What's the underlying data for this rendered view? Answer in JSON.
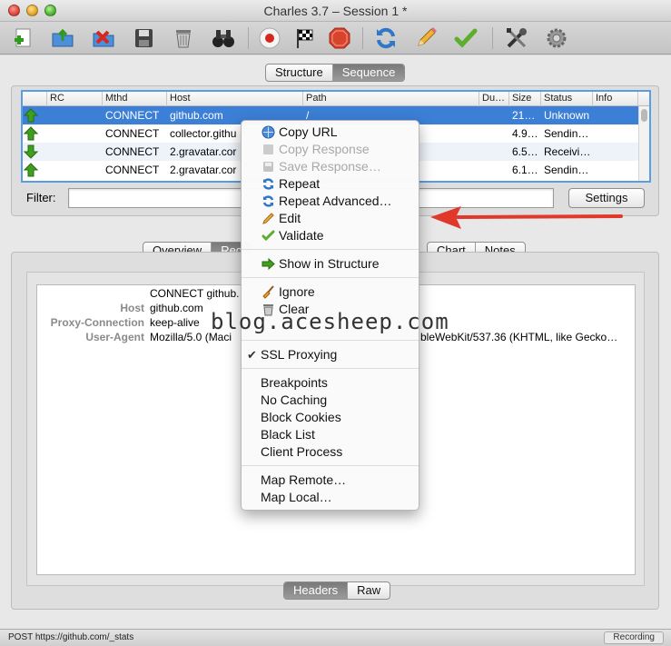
{
  "window": {
    "title": "Charles 3.7 – Session 1 *"
  },
  "toolbar": {
    "buttons": [
      "new-session-icon",
      "open-session-icon",
      "close-session-icon",
      "save-icon",
      "trash-icon",
      "binoculars-icon",
      "record-icon",
      "throttle-flag-icon",
      "breakpoints-stop-icon",
      "repeat-icon",
      "edit-pencil-icon",
      "validate-check-icon",
      "tools-icon",
      "settings-gear-icon"
    ]
  },
  "view_tabs": {
    "structure": "Structure",
    "sequence": "Sequence",
    "active": "Sequence"
  },
  "table": {
    "columns": [
      "RC",
      "Mthd",
      "Host",
      "Path",
      "Du…",
      "Size",
      "Status",
      "Info"
    ],
    "rows": [
      {
        "direction": "up",
        "rc": "",
        "method": "CONNECT",
        "host": "github.com",
        "path": "/",
        "duration": "",
        "size": "21…",
        "status": "Unknown",
        "info": "",
        "selected": true
      },
      {
        "direction": "up",
        "rc": "",
        "method": "CONNECT",
        "host": "collector.githu",
        "path": "",
        "duration": "",
        "size": "4.9…",
        "status": "Sendin…",
        "info": "",
        "selected": false
      },
      {
        "direction": "down",
        "rc": "",
        "method": "CONNECT",
        "host": "2.gravatar.cor",
        "path": "",
        "duration": "",
        "size": "6.5…",
        "status": "Receivi…",
        "info": "",
        "selected": false
      },
      {
        "direction": "up",
        "rc": "",
        "method": "CONNECT",
        "host": "2.gravatar.cor",
        "path": "",
        "duration": "",
        "size": "6.1…",
        "status": "Sendin…",
        "info": "",
        "selected": false
      }
    ]
  },
  "filter": {
    "label": "Filter:",
    "value": "",
    "settings_label": "Settings"
  },
  "detail_tabs": {
    "overview": "Overview",
    "request": "Rec",
    "chart": "Chart",
    "notes": "Notes",
    "active": "Rec"
  },
  "request_detail": {
    "request_line": "CONNECT github.",
    "headers": [
      {
        "key": "Host",
        "value": "github.com"
      },
      {
        "key": "Proxy-Connection",
        "value": "keep-alive"
      },
      {
        "key": "User-Agent",
        "value": "Mozilla/5.0 (Maci"
      }
    ],
    "user_agent_tail": "bleWebKit/537.36 (KHTML, like Gecko…"
  },
  "bottom_tabs": {
    "headers": "Headers",
    "raw": "Raw",
    "active": "Headers"
  },
  "watermark": "blog.acesheep.com",
  "context_menu": {
    "items": [
      {
        "label": "Copy URL",
        "icon": "copy-url-icon",
        "disabled": false
      },
      {
        "label": "Copy Response",
        "icon": "copy-response-icon",
        "disabled": true
      },
      {
        "label": "Save Response…",
        "icon": "save-response-icon",
        "disabled": true
      },
      {
        "label": "Repeat",
        "icon": "repeat-icon",
        "disabled": false
      },
      {
        "label": "Repeat Advanced…",
        "icon": "repeat-advanced-icon",
        "disabled": false
      },
      {
        "label": "Edit",
        "icon": "pencil-icon",
        "disabled": false
      },
      {
        "label": "Validate",
        "icon": "check-icon",
        "disabled": false
      },
      {
        "label": "Show in Structure",
        "icon": "arrow-right-icon",
        "disabled": false
      },
      {
        "label": "Ignore",
        "icon": "broom-icon",
        "disabled": false
      },
      {
        "label": "Clear",
        "icon": "trash-icon",
        "disabled": false
      },
      {
        "label": "SSL Proxying",
        "checked": true
      },
      {
        "label": "Breakpoints"
      },
      {
        "label": "No Caching"
      },
      {
        "label": "Block Cookies"
      },
      {
        "label": "Black List"
      },
      {
        "label": "Client Process"
      },
      {
        "label": "Map Remote…"
      },
      {
        "label": "Map Local…"
      }
    ]
  },
  "status_bar": {
    "text": "POST https://github.com/_stats",
    "badge": "Recording"
  },
  "colors": {
    "selection": "#3c7fd6",
    "table_border": "#5a9de0",
    "annotation_arrow": "#e0392b",
    "up_arrow": "#3f9f1f"
  }
}
